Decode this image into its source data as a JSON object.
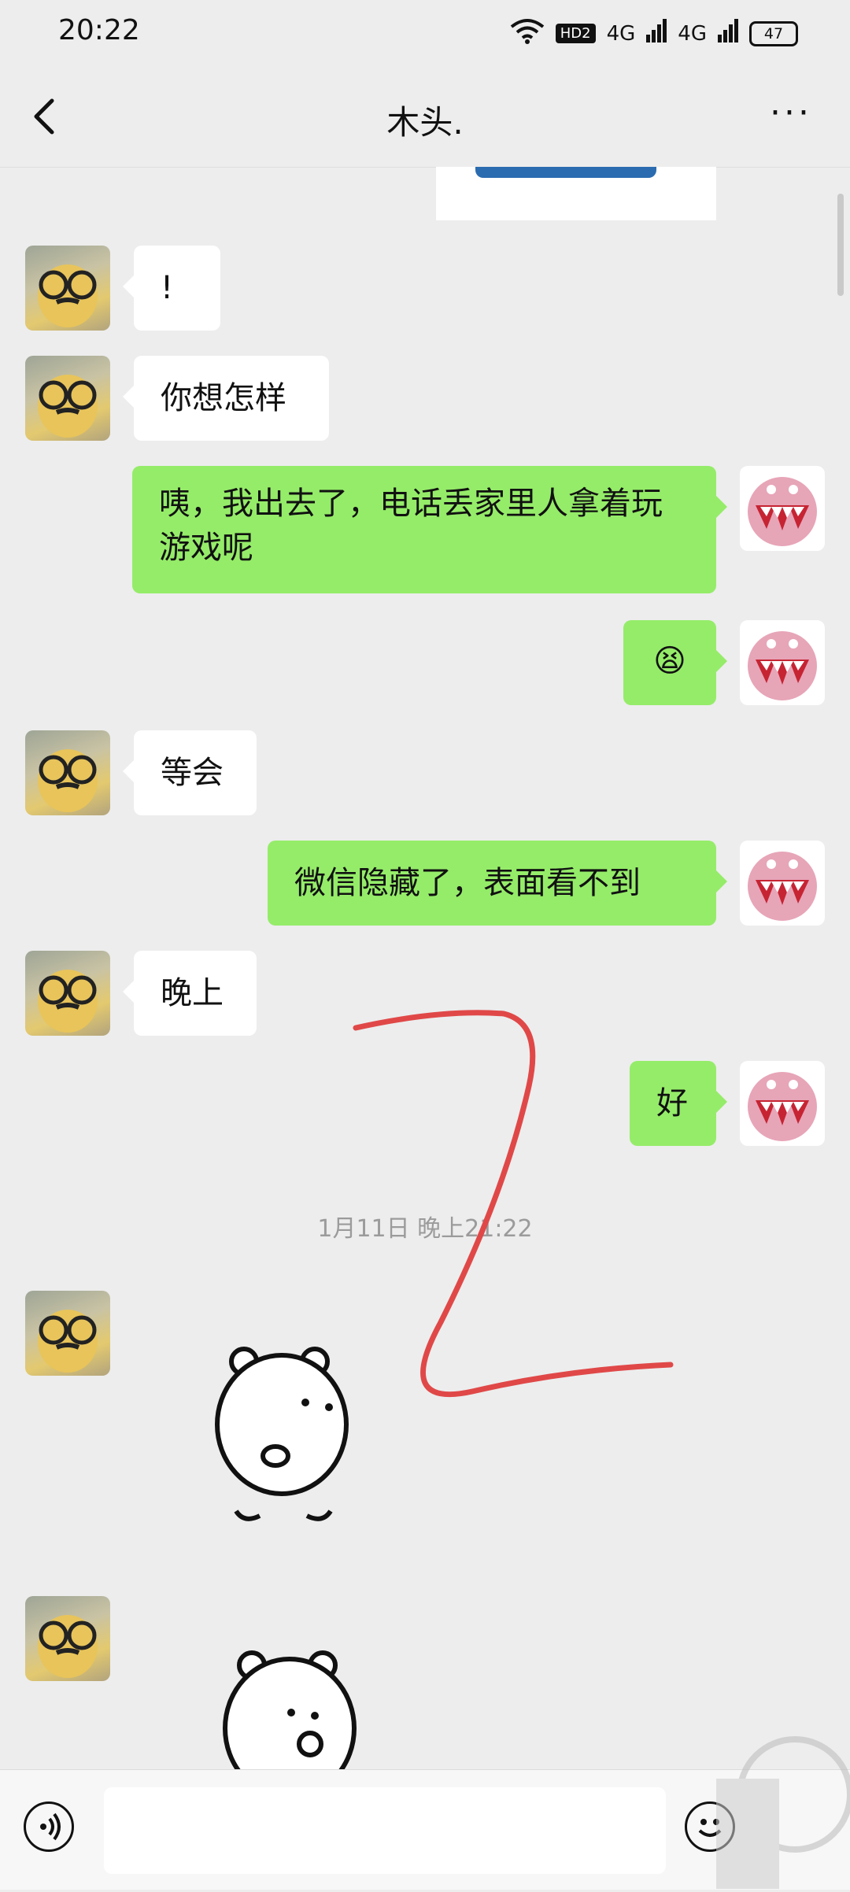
{
  "status_bar": {
    "time": "20:22",
    "hd_badge": "HD2",
    "signal_1": "4G",
    "signal_2": "4G",
    "battery": "47"
  },
  "nav": {
    "title": "木头.",
    "back_icon": "chevron-left-icon",
    "more_label": "···"
  },
  "colors": {
    "background": "#ededed",
    "sent_bubble": "#95ec69",
    "received_bubble": "#ffffff",
    "annotation_stroke": "#e04848"
  },
  "messages": [
    {
      "side": "left",
      "text": "!"
    },
    {
      "side": "left",
      "text": "你想怎样"
    },
    {
      "side": "right",
      "text": "咦，我出去了，电话丢家里人拿着玩游戏呢"
    },
    {
      "side": "right",
      "text": "😫"
    },
    {
      "side": "left",
      "text": "等会"
    },
    {
      "side": "right",
      "text": "微信隐藏了，表面看不到"
    },
    {
      "side": "left",
      "text": "晚上"
    },
    {
      "side": "right",
      "text": "好"
    }
  ],
  "time_divider": "1月11日 晚上21:22",
  "stickers": [
    {
      "side": "left",
      "name": "white-bear-sticker-back"
    },
    {
      "side": "left",
      "name": "white-bear-sticker-thinking"
    }
  ],
  "input": {
    "placeholder": "",
    "voice_icon": "voice-icon",
    "emoji_icon": "emoji-icon"
  }
}
